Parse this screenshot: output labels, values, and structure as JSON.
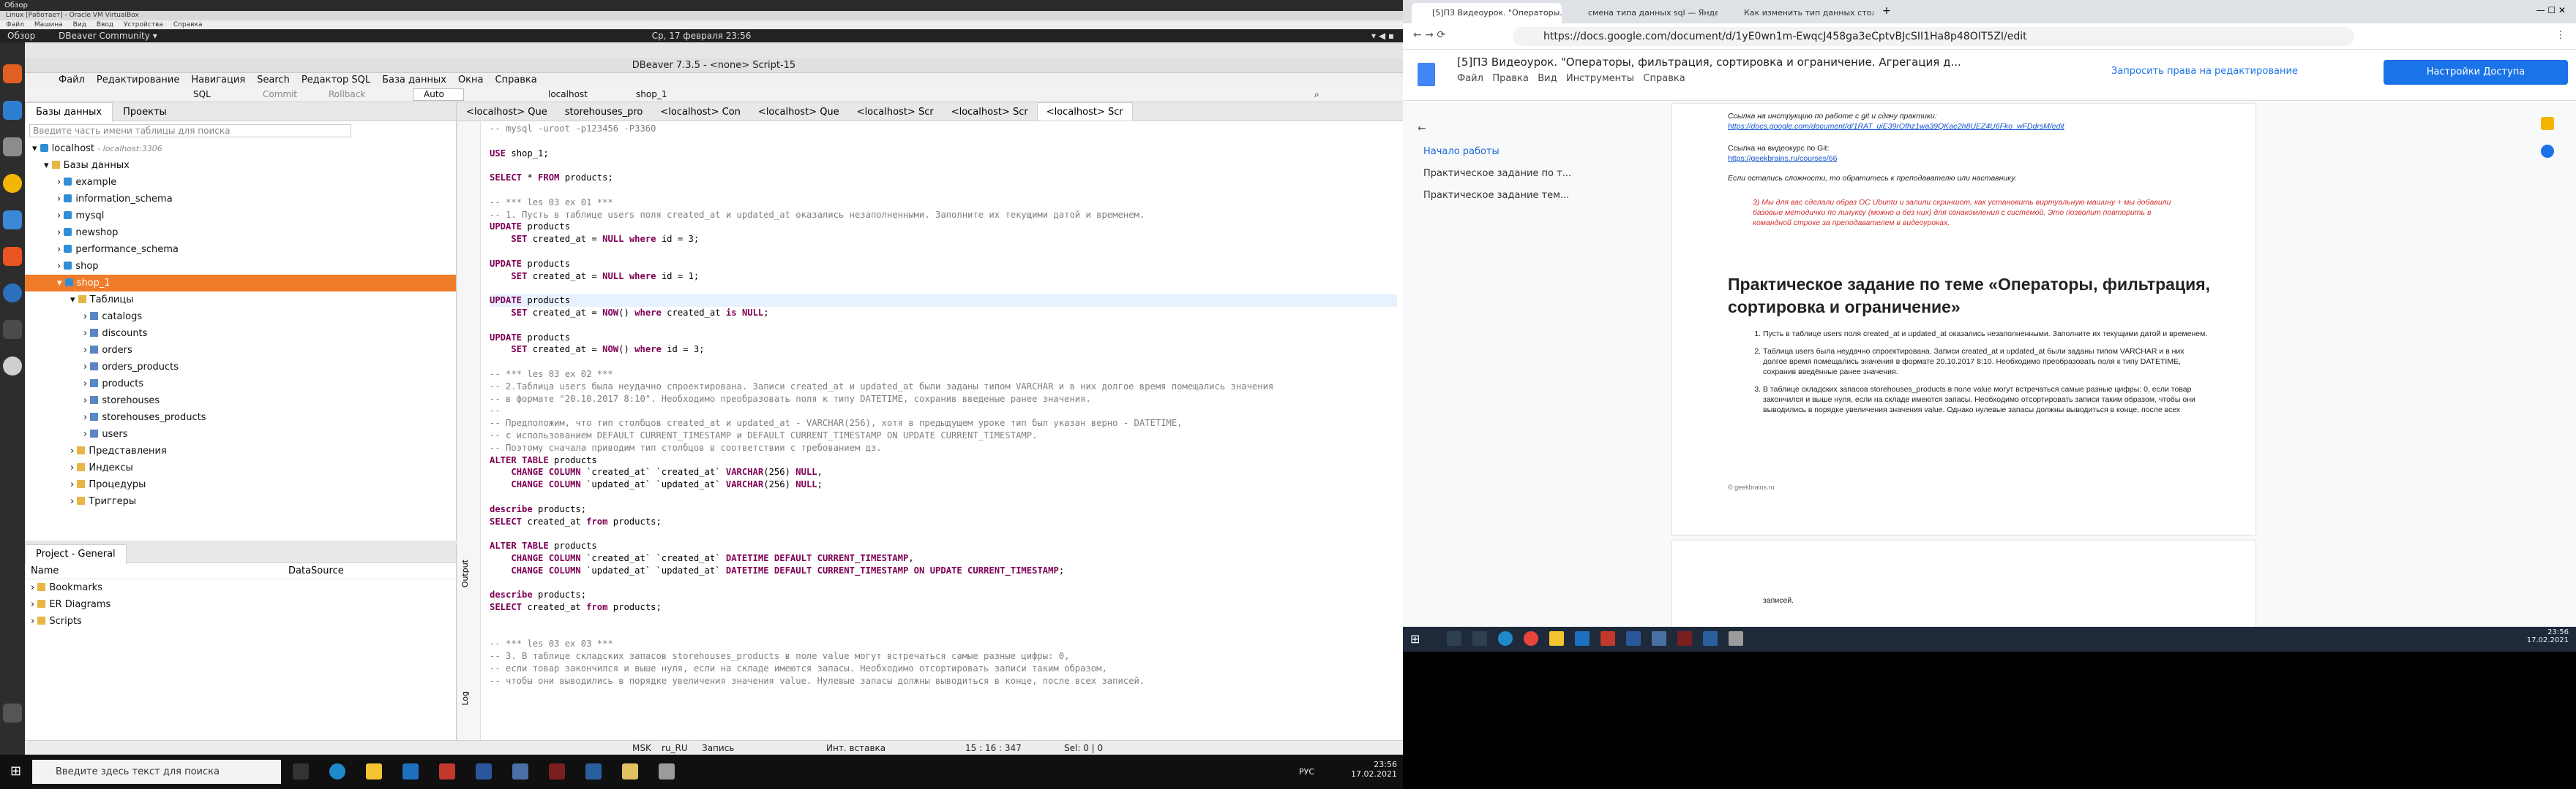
{
  "ubuntu": {
    "app": "Обзор",
    "window": "DBeaver Community ▾",
    "clock": "Ср, 17 февраля 23:56"
  },
  "vbox": {
    "title": "Linux [Работает] - Oracle VM VirtualBox",
    "menu": [
      "Файл",
      "Машина",
      "Вид",
      "Ввод",
      "Устройства",
      "Справка"
    ]
  },
  "dbeaver": {
    "title": "DBeaver 7.3.5 - <none> Script-15",
    "menu": [
      "Файл",
      "Редактирование",
      "Навигация",
      "Search",
      "Редактор SQL",
      "База данных",
      "Окна",
      "Справка"
    ],
    "toolbar": {
      "sql": "SQL",
      "commit": "Commit",
      "rollback": "Rollback",
      "auto": "Auto",
      "conn": "localhost",
      "db": "shop_1"
    },
    "nav_tabs": [
      "Базы данных",
      "Проекты"
    ],
    "filter_placeholder": "Введите часть имени таблицы для поиска",
    "tree": {
      "conn": "localhost",
      "conn_host": "- localhost:3306",
      "dbs": "Базы данных",
      "databases": [
        "example",
        "information_schema",
        "mysql",
        "newshop",
        "performance_schema",
        "shop",
        "shop_1"
      ],
      "tables_folder": "Таблицы",
      "tables": [
        "catalogs",
        "discounts",
        "orders",
        "orders_products",
        "products",
        "storehouses",
        "storehouses_products",
        "users"
      ],
      "folders": [
        "Представления",
        "Индексы",
        "Процедуры",
        "Триггеры"
      ]
    },
    "project": {
      "title": "Project - General",
      "col_name": "Name",
      "col_ds": "DataSource",
      "items": [
        "Bookmarks",
        "ER Diagrams",
        "Scripts"
      ]
    },
    "editor_tabs": [
      "<localhost> Que",
      "storehouses_pro",
      "<localhost> Con",
      "<localhost> Que",
      "<localhost> Scr",
      "<localhost> Scr",
      "<localhost> Scr"
    ],
    "side_labels": [
      "Output",
      "Log"
    ],
    "status": {
      "msk": "MSK",
      "locale": "ru_RU",
      "mode": "Запись",
      "insert": "Инт. вставка",
      "pos": "15 : 16 : 347",
      "sel": "Sel: 0 | 0"
    }
  },
  "code": [
    {
      "t": "cm",
      "s": "-- mysql -uroot -p123456 -P3360"
    },
    {
      "t": "",
      "s": ""
    },
    {
      "t": "mix",
      "s": [
        [
          "kw",
          "USE "
        ],
        [
          "",
          "shop_1;"
        ]
      ]
    },
    {
      "t": "",
      "s": ""
    },
    {
      "t": "mix",
      "s": [
        [
          "kw",
          "SELECT"
        ],
        [
          "",
          " * "
        ],
        [
          "kw",
          "FROM"
        ],
        [
          "",
          " products;"
        ]
      ]
    },
    {
      "t": "",
      "s": ""
    },
    {
      "t": "cm",
      "s": "-- *** les 03 ex 01 ***"
    },
    {
      "t": "cm",
      "s": "-- 1. Пусть в таблице users поля created_at и updated_at оказались незаполненными. Заполните их текущими датой и временем."
    },
    {
      "t": "mix",
      "s": [
        [
          "kw",
          "UPDATE"
        ],
        [
          "",
          " products"
        ]
      ]
    },
    {
      "t": "mix",
      "s": [
        [
          "",
          "    "
        ],
        [
          "kw",
          "SET"
        ],
        [
          "",
          " created_at = "
        ],
        [
          "kw",
          "NULL"
        ],
        [
          "",
          " "
        ],
        [
          "kw",
          "where"
        ],
        [
          "",
          " id = 3;"
        ]
      ]
    },
    {
      "t": "",
      "s": ""
    },
    {
      "t": "mix",
      "s": [
        [
          "kw",
          "UPDATE"
        ],
        [
          "",
          " products"
        ]
      ]
    },
    {
      "t": "mix",
      "s": [
        [
          "",
          "    "
        ],
        [
          "kw",
          "SET"
        ],
        [
          "",
          " created_at = "
        ],
        [
          "kw",
          "NULL"
        ],
        [
          "",
          " "
        ],
        [
          "kw",
          "where"
        ],
        [
          "",
          " id = 1;"
        ]
      ]
    },
    {
      "t": "",
      "s": ""
    },
    {
      "t": "cur",
      "s": [
        [
          "kw",
          "UPDATE"
        ],
        [
          "",
          " products"
        ]
      ]
    },
    {
      "t": "mix",
      "s": [
        [
          "",
          "    "
        ],
        [
          "kw",
          "SET"
        ],
        [
          "",
          " created_at = "
        ],
        [
          "kw",
          "NOW"
        ],
        [
          "",
          "() "
        ],
        [
          "kw",
          "where"
        ],
        [
          "",
          " created_at "
        ],
        [
          "kw",
          "is NULL"
        ],
        [
          "",
          ";"
        ]
      ]
    },
    {
      "t": "",
      "s": ""
    },
    {
      "t": "mix",
      "s": [
        [
          "kw",
          "UPDATE"
        ],
        [
          "",
          " products"
        ]
      ]
    },
    {
      "t": "mix",
      "s": [
        [
          "",
          "    "
        ],
        [
          "kw",
          "SET"
        ],
        [
          "",
          " created_at = "
        ],
        [
          "kw",
          "NOW"
        ],
        [
          "",
          "() "
        ],
        [
          "kw",
          "where"
        ],
        [
          "",
          " id = 3;"
        ]
      ]
    },
    {
      "t": "",
      "s": ""
    },
    {
      "t": "cm",
      "s": "-- *** les 03 ex 02 ***"
    },
    {
      "t": "cm",
      "s": "-- 2.Таблица users была неудачно спроектирована. Записи created_at и updated_at были заданы типом VARCHAR и в них долгое время помещались значения"
    },
    {
      "t": "cm",
      "s": "-- в формате \"20.10.2017 8:10\". Необходимо преобразовать поля к типу DATETIME, сохранив введеные ранее значения."
    },
    {
      "t": "cm",
      "s": "--"
    },
    {
      "t": "cm",
      "s": "-- Предположим, что тип столбцов created_at и updated_at - VARCHAR(256), хотя в предыдущем уроке тип был указан верно - DATETIME,"
    },
    {
      "t": "cm",
      "s": "-- с использованием DEFAULT CURRENT_TIMESTAMP и DEFAULT CURRENT_TIMESTAMP ON UPDATE CURRENT_TIMESTAMP."
    },
    {
      "t": "cm",
      "s": "-- Поэтому сначала приводим тип столбцов в соответствии с требованием дз."
    },
    {
      "t": "mix",
      "s": [
        [
          "kw",
          "ALTER TABLE"
        ],
        [
          "",
          " products"
        ]
      ]
    },
    {
      "t": "mix",
      "s": [
        [
          "",
          "    "
        ],
        [
          "kw",
          "CHANGE COLUMN"
        ],
        [
          "",
          " `created_at` `created_at` "
        ],
        [
          "kw",
          "VARCHAR"
        ],
        [
          "",
          "(256) "
        ],
        [
          "kw",
          "NULL"
        ],
        [
          "",
          ","
        ]
      ]
    },
    {
      "t": "mix",
      "s": [
        [
          "",
          "    "
        ],
        [
          "kw",
          "CHANGE COLUMN"
        ],
        [
          "",
          " `updated_at` `updated_at` "
        ],
        [
          "kw",
          "VARCHAR"
        ],
        [
          "",
          "(256) "
        ],
        [
          "kw",
          "NULL"
        ],
        [
          "",
          ";"
        ]
      ]
    },
    {
      "t": "",
      "s": ""
    },
    {
      "t": "mix",
      "s": [
        [
          "kw",
          "describe"
        ],
        [
          "",
          " products;"
        ]
      ]
    },
    {
      "t": "mix",
      "s": [
        [
          "kw",
          "SELECT"
        ],
        [
          "",
          " created_at "
        ],
        [
          "kw",
          "from"
        ],
        [
          "",
          " products;"
        ]
      ]
    },
    {
      "t": "",
      "s": ""
    },
    {
      "t": "mix",
      "s": [
        [
          "kw",
          "ALTER TABLE"
        ],
        [
          "",
          " products"
        ]
      ]
    },
    {
      "t": "mix",
      "s": [
        [
          "",
          "    "
        ],
        [
          "kw",
          "CHANGE COLUMN"
        ],
        [
          "",
          " `created_at` `created_at` "
        ],
        [
          "kw",
          "DATETIME DEFAULT CURRENT_TIMESTAMP"
        ],
        [
          "",
          ","
        ]
      ]
    },
    {
      "t": "mix",
      "s": [
        [
          "",
          "    "
        ],
        [
          "kw",
          "CHANGE COLUMN"
        ],
        [
          "",
          " `updated_at` `updated_at` "
        ],
        [
          "kw",
          "DATETIME DEFAULT CURRENT_TIMESTAMP ON UPDATE CURRENT_TIMESTAMP"
        ],
        [
          "",
          ";"
        ]
      ]
    },
    {
      "t": "",
      "s": ""
    },
    {
      "t": "mix",
      "s": [
        [
          "kw",
          "describe"
        ],
        [
          "",
          " products;"
        ]
      ]
    },
    {
      "t": "mix",
      "s": [
        [
          "kw",
          "SELECT"
        ],
        [
          "",
          " created_at "
        ],
        [
          "kw",
          "from"
        ],
        [
          "",
          " products;"
        ]
      ]
    },
    {
      "t": "",
      "s": ""
    },
    {
      "t": "",
      "s": ""
    },
    {
      "t": "cm",
      "s": "-- *** les 03 ex 03 ***"
    },
    {
      "t": "cm",
      "s": "-- 3. В таблице складских запасов storehouses_products в поле value могут встречаться самые разные цифры: 0,"
    },
    {
      "t": "cm",
      "s": "-- если товар закончился и выше нуля, если на складе имеются запасы. Необходимо отсортировать записи таким образом,"
    },
    {
      "t": "cm",
      "s": "-- чтобы они выводились в порядке увеличения значения value. Нулевые запасы должны выводиться в конце, после всех записей."
    }
  ],
  "win_left": {
    "search": "Введите здесь текст для поиска",
    "time": "23:56",
    "date": "17.02.2021",
    "lang": "РУС"
  },
  "chrome": {
    "tabs": [
      "[5]ПЗ Видеоурок. \"Операторы...",
      "смена типа данных sql — Янде...",
      "Как изменить тип данных стол..."
    ],
    "url": "https://docs.google.com/document/d/1yE0wn1m-EwqcJ458ga3eCptvBJcSII1Ha8p48OIT5ZI/edit"
  },
  "gdoc": {
    "title": "[5]ПЗ Видеоурок. \"Операторы, фильтрация, сортировка и ограничение. Агрегация д...",
    "menu": [
      "Файл",
      "Правка",
      "Вид",
      "Инструменты",
      "Справка"
    ],
    "request": "Запросить права на редактирование",
    "access": "Настройки Доступа",
    "outline": [
      "Начало работы",
      "Практическое задание по т...",
      "Практическое задание тем..."
    ],
    "p1": "Ссылка на инструкцию по работе с git и сдачу практики:",
    "p1link": "https://docs.google.com/document/d/1RAT_uiE39rOfhz1wa39QKae2h8UEZ4U6Fko_wFDdrsM/edit",
    "p2": "Ссылка на видеокурс по Git:",
    "p2link": "https://geekbrains.ru/courses/66",
    "p3": "Если остались сложности, то обратитесь к преподавателю или наставнику.",
    "red": "3)  Мы для вас сделали образ ОС Ubuntu и залили скриншот, как установить виртуальную машину + мы добавили базовые методички по линуксу (можно и без них) для ознакомления с системой. Это позволит повторить в командной строке за преподавателем в видеоуроках.",
    "heading": "Практическое задание по теме «Операторы, фильтрация, сортировка и ограничение»",
    "items": [
      "Пусть в таблице users поля created_at и updated_at оказались незаполненными. Заполните их текущими датой и временем.",
      "Таблица users была неудачно спроектирована. Записи created_at и updated_at были заданы типом VARCHAR и в них долгое время помещались значения в формате 20.10.2017 8:10. Необходимо преобразовать поля к типу DATETIME, сохранив введённые ранее значения.",
      "В таблице складских запасов storehouses_products в поле value могут встречаться самые разные цифры: 0, если товар закончился и выше нуля, если на складе имеются запасы. Необходимо отсортировать записи таким образом, чтобы они выводились в порядке увеличения значения value. Однако нулевые запасы должны выводиться в конце, после всех"
    ],
    "footer": "© geekbrains.ru",
    "next": "записей."
  },
  "win_right": {
    "time": "23:56",
    "date": "17.02.2021"
  }
}
